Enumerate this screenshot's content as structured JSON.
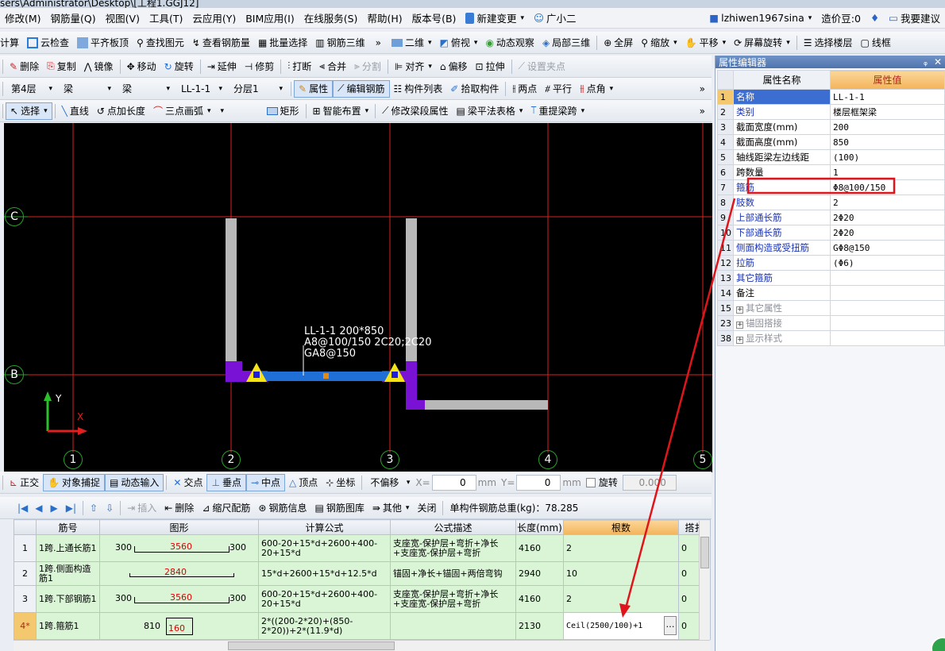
{
  "title_fragment": "sers\\Administrator\\Desktop\\[工程1.GGJ12]",
  "menu": [
    "修改(M)",
    "钢筋量(Q)",
    "视图(V)",
    "工具(T)",
    "云应用(Y)",
    "BIM应用(I)",
    "在线服务(S)",
    "帮助(H)",
    "版本号(B)",
    "新建变更",
    "广小二"
  ],
  "user": {
    "name": "lzhiwen1967sina",
    "coins": "造价豆:0",
    "suggest": "我要建议"
  },
  "toolbar1": [
    "计算",
    "云检查",
    "平齐板顶",
    "查找图元",
    "查看钢筋量",
    "批量选择",
    "钢筋三维",
    "二维",
    "俯视",
    "动态观察",
    "局部三维",
    "全屏",
    "缩放",
    "平移",
    "屏幕旋转",
    "选择楼层",
    "线框"
  ],
  "toolbar2": [
    "删除",
    "复制",
    "镜像",
    "移动",
    "旋转",
    "延伸",
    "修剪",
    "打断",
    "合并",
    "分割",
    "对齐",
    "偏移",
    "拉伸",
    "设置夹点"
  ],
  "toolbar3": {
    "floor": "第4层",
    "type": "梁",
    "subtype": "梁",
    "element": "LL-1-1",
    "layer": "分层1",
    "items": [
      "属性",
      "编辑钢筋",
      "构件列表",
      "拾取构件",
      "两点",
      "平行",
      "点角"
    ]
  },
  "toolbar4": [
    "选择",
    "直线",
    "点加长度",
    "三点画弧",
    "矩形",
    "智能布置",
    "修改梁段属性",
    "梁平法表格",
    "重提梁跨"
  ],
  "canvas": {
    "axes_v": [
      "1",
      "2",
      "3",
      "4",
      "5"
    ],
    "axes_h": [
      "C",
      "B"
    ],
    "note": [
      "LL-1-1 200*850",
      "A8@100/150 2C20;2C20",
      "GA8@150"
    ],
    "ucs_y": "Y",
    "ucs_x": "X"
  },
  "snapbar": {
    "items": [
      "正交",
      "对象捕捉",
      "动态输入",
      "交点",
      "垂点",
      "中点",
      "顶点",
      "坐标"
    ],
    "offset": "不偏移",
    "x_label": "X=",
    "x_val": "0",
    "y_label": "Y=",
    "y_val": "0",
    "unit": "mm",
    "rotate": "旋转",
    "rotate_val": "0.000"
  },
  "rebar_toolbar": {
    "items": [
      "插入",
      "删除",
      "缩尺配筋",
      "钢筋信息",
      "钢筋图库",
      "其他",
      "关闭"
    ],
    "total": "单构件钢筋总重(kg)：78.285"
  },
  "rebar_table": {
    "headers": [
      "筋号",
      "图形",
      "计算公式",
      "公式描述",
      "长度(mm)",
      "根数",
      "搭扌"
    ],
    "rows": [
      {
        "idx": "1",
        "name": "1跨.上通长筋1",
        "shape": {
          "left": "300",
          "mid": "3560",
          "right": "300"
        },
        "formula": "600-20+15*d+2600+400-20+15*d",
        "desc": "支座宽-保护层+弯折+净长+支座宽-保护层+弯折",
        "len": "4160",
        "count": "2",
        "lap": "0"
      },
      {
        "idx": "2",
        "name": "1跨.侧面构造筋1",
        "shape": {
          "left": "",
          "mid": "2840",
          "right": ""
        },
        "formula": "15*d+2600+15*d+12.5*d",
        "desc": "锚固+净长+锚固+两倍弯钩",
        "len": "2940",
        "count": "10",
        "lap": "0"
      },
      {
        "idx": "3",
        "name": "1跨.下部钢筋1",
        "shape": {
          "left": "300",
          "mid": "3560",
          "right": "300"
        },
        "formula": "600-20+15*d+2600+400-20+15*d",
        "desc": "支座宽-保护层+弯折+净长+支座宽-保护层+弯折",
        "len": "4160",
        "count": "2",
        "lap": "0"
      },
      {
        "idx": "4*",
        "name": "1跨.箍筋1",
        "shape": {
          "left": "810",
          "mid": "160",
          "right": ""
        },
        "formula": "2*((200-2*20)+(850-2*20))+2*(11.9*d)",
        "desc": "",
        "len": "2130",
        "count": "Ceil(2500/100)+1",
        "lap": "0"
      }
    ]
  },
  "prop": {
    "title": "属性编辑器",
    "col_name": "属性名称",
    "col_val": "属性值",
    "rows": [
      {
        "n": "1",
        "name": "名称",
        "val": "LL-1-1"
      },
      {
        "n": "2",
        "name": "类别",
        "val": "楼层框架梁"
      },
      {
        "n": "3",
        "name": "截面宽度(mm)",
        "val": "200"
      },
      {
        "n": "4",
        "name": "截面高度(mm)",
        "val": "850"
      },
      {
        "n": "5",
        "name": "轴线距梁左边线距",
        "val": "(100)"
      },
      {
        "n": "6",
        "name": "跨数量",
        "val": "1"
      },
      {
        "n": "7",
        "name": "箍筋",
        "val": "Φ8@100/150"
      },
      {
        "n": "8",
        "name": "肢数",
        "val": "2"
      },
      {
        "n": "9",
        "name": "上部通长筋",
        "val": "2Φ20"
      },
      {
        "n": "10",
        "name": "下部通长筋",
        "val": "2Φ20"
      },
      {
        "n": "11",
        "name": "侧面构造或受扭筋",
        "val": "GΦ8@150"
      },
      {
        "n": "12",
        "name": "拉筋",
        "val": "(Φ6)"
      },
      {
        "n": "13",
        "name": "其它箍筋",
        "val": ""
      },
      {
        "n": "14",
        "name": "备注",
        "val": ""
      },
      {
        "n": "15",
        "name": "其它属性",
        "val": ""
      },
      {
        "n": "23",
        "name": "锚固搭接",
        "val": ""
      },
      {
        "n": "38",
        "name": "显示样式",
        "val": ""
      }
    ]
  },
  "colors": {
    "highlight_box": "#e0151b",
    "arrow": "#e0151b",
    "beam": "#1f6fd6",
    "column": "#7a12d6",
    "wall": "#b8b8b8",
    "axis": "#d81f1f"
  }
}
